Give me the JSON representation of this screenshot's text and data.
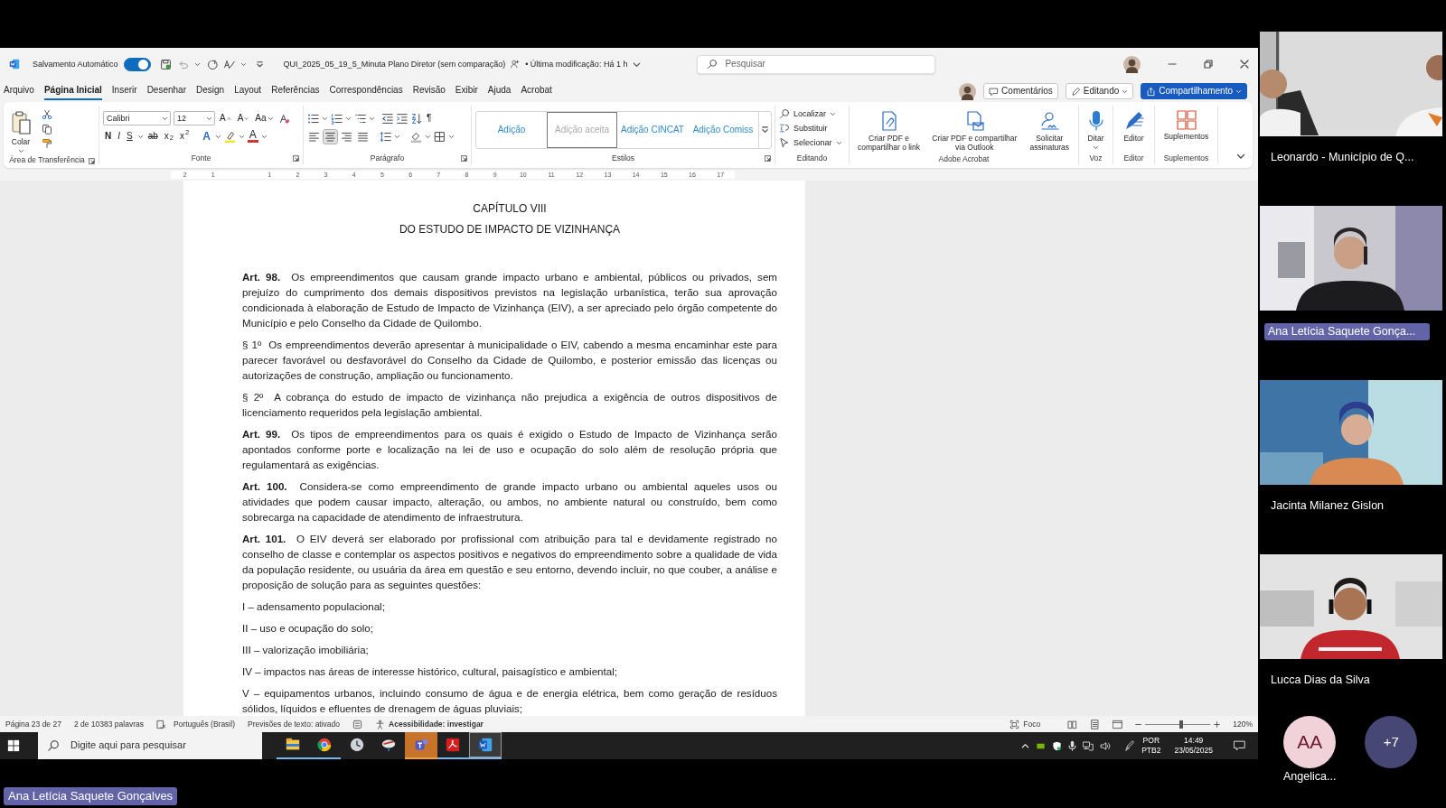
{
  "title_bar": {
    "autosave_label": "Salvamento Automático",
    "autosave_on": true,
    "document_title": "QUI_2025_05_19_5_Minuta Plano Diretor (sem comparação)",
    "last_modified": "• Última modificação: Há 1 h",
    "search_placeholder": "Pesquisar"
  },
  "ribbon_tabs": [
    {
      "label": "Arquivo",
      "selected": false
    },
    {
      "label": "Página Inicial",
      "selected": true
    },
    {
      "label": "Inserir",
      "selected": false
    },
    {
      "label": "Desenhar",
      "selected": false
    },
    {
      "label": "Design",
      "selected": false
    },
    {
      "label": "Layout",
      "selected": false
    },
    {
      "label": "Referências",
      "selected": false
    },
    {
      "label": "Correspondências",
      "selected": false
    },
    {
      "label": "Revisão",
      "selected": false
    },
    {
      "label": "Exibir",
      "selected": false
    },
    {
      "label": "Ajuda",
      "selected": false
    },
    {
      "label": "Acrobat",
      "selected": false
    }
  ],
  "header_buttons": {
    "comments": "Comentários",
    "editing": "Editando",
    "share": "Compartilhamento"
  },
  "ribbon": {
    "clipboard": {
      "paste": "Colar",
      "group": "Área de Transferência"
    },
    "font": {
      "name": "Calibri",
      "size": "12",
      "size_buttons": [
        "A",
        "A"
      ],
      "case_button": "Aa",
      "format_buttons": [
        "N",
        "I",
        "S",
        "ab",
        "x$_{2}$",
        "x$^{2}$"
      ],
      "effect_buttons": [
        "A",
        "A"
      ],
      "group": "Fonte"
    },
    "paragraph": {
      "pilcrow": "¶",
      "align_buttons": [
        {
          "selected": false
        },
        {
          "selected": true
        },
        {
          "selected": false
        },
        {
          "selected": false
        }
      ],
      "group": "Parágrafo"
    },
    "styles": {
      "items": [
        {
          "label": "Adição",
          "selected": false
        },
        {
          "label": "Adição aceita",
          "selected": true
        },
        {
          "label": "Adição CINCAT",
          "selected": false
        },
        {
          "label": "Adição Comiss",
          "selected": false
        }
      ],
      "group": "Estilos"
    },
    "editing": {
      "items": [
        "Localizar",
        "Substituir",
        "Selecionar"
      ],
      "group": "Editando"
    },
    "acrobat": {
      "items": [
        "Criar PDF e compartilhar o link",
        "Criar PDF e compartilhar via Outlook",
        "Solicitar assinaturas"
      ],
      "group": "Adobe Acrobat"
    },
    "voice": {
      "button": "Ditar",
      "group": "Voz"
    },
    "editor": {
      "button": "Editor",
      "group": "Editor"
    },
    "addins": {
      "button": "Suplementos",
      "group": "Suplementos"
    }
  },
  "ruler": {
    "marks": [
      "2",
      "1",
      "1",
      "2",
      "3",
      "4",
      "5",
      "6",
      "7",
      "8",
      "9",
      "10",
      "11",
      "12",
      "13",
      "14",
      "15",
      "16",
      "17"
    ]
  },
  "document": {
    "blocks": [
      {
        "kind": "heading",
        "text": "CAPÍTULO VIII"
      },
      {
        "kind": "heading",
        "text": "DO ESTUDO DE IMPACTO DE VIZINHANÇA"
      },
      {
        "kind": "paragraph",
        "text": "**Art. 98.**  Os empreendimentos que causam grande impacto urbano e ambiental, públicos ou privados, sem prejuízo do cumprimento dos demais dispositivos previstos na legislação urbanística, terão sua aprovação condicionada à elaboração de Estudo de Impacto de Vizinhança (EIV), a ser apreciado pelo órgão competente do Município e pelo Conselho da Cidade de Quilombo."
      },
      {
        "kind": "paragraph",
        "text": "§ 1º  Os empreendimentos deverão apresentar à municipalidade o EIV, cabendo a mesma encaminhar este para parecer favorável ou desfavorável do Conselho da Cidade de Quilombo, e posterior emissão das licenças ou autorizações de construção, ampliação ou funcionamento."
      },
      {
        "kind": "paragraph",
        "text": "§ 2º  A cobrança do estudo de impacto de vizinhança não prejudica a exigência de outros dispositivos de licenciamento requeridos pela legislação ambiental."
      },
      {
        "kind": "paragraph",
        "text": "**Art. 99.**  Os tipos de empreendimentos para os quais é exigido o Estudo de Impacto de Vizinhança serão apontados conforme porte e localização na lei de uso e ocupação do solo além de resolução própria que regulamentará as exigências."
      },
      {
        "kind": "paragraph",
        "text": "**Art. 100.**  Considera-se como empreendimento de grande impacto urbano ou ambiental aqueles usos ou atividades que podem causar impacto, alteração, ou ambos, no ambiente natural ou construído, bem como sobrecarga na capacidade de atendimento de infraestrutura."
      },
      {
        "kind": "paragraph",
        "text": "**Art. 101.**  O EIV deverá ser elaborado por profissional com atribuição para tal e devidamente registrado no conselho de classe e contemplar os aspectos positivos e negativos do empreendimento sobre a qualidade de vida da população residente, ou usuária da área em questão e seu entorno, devendo incluir, no que couber, a análise e proposição de solução para as seguintes questões:"
      },
      {
        "kind": "item",
        "text": "I – adensamento populacional;"
      },
      {
        "kind": "item",
        "text": "II – uso e ocupação do solo;"
      },
      {
        "kind": "item",
        "text": "III – valorização imobiliária;"
      },
      {
        "kind": "item",
        "text": "IV – impactos nas áreas de interesse histórico, cultural, paisagístico e ambiental;"
      },
      {
        "kind": "paragraph",
        "text": "V – equipamentos urbanos, incluindo consumo de água e de energia elétrica, bem como geração de resíduos sólidos, líquidos e efluentes de drenagem de águas pluviais;"
      }
    ]
  },
  "status_bar": {
    "page": "Página 23 de 27",
    "words": "2 de 10383 palavras",
    "language": "Português (Brasil)",
    "predictions": "Previsões de texto: ativado",
    "accessibility": "Acessibilidade: investigar",
    "focus": "Foco",
    "zoom_slider": {
      "level": 0.56
    },
    "zoom": "120%"
  },
  "taskbar": {
    "search_placeholder": "Digite aqui para pesquisar",
    "apps": [
      {
        "open": true,
        "selected": false,
        "attention": false
      },
      {
        "open": true,
        "selected": false,
        "attention": false
      },
      {
        "open": false,
        "selected": false,
        "attention": false
      },
      {
        "open": false,
        "selected": false,
        "attention": false
      },
      {
        "open": true,
        "selected": false,
        "attention": true
      },
      {
        "open": true,
        "selected": false,
        "attention": false
      },
      {
        "open": true,
        "selected": true,
        "attention": false
      }
    ],
    "language": "POR",
    "layout": "PTB2",
    "time": "14:49",
    "date": "23/05/2025"
  },
  "participants": [
    {
      "name": "Leonardo - Município de Q...",
      "highlighted": false
    },
    {
      "name": "Ana Letícia Saquete Gonça...",
      "highlighted": true
    },
    {
      "name": "Jacinta Milanez Gislon",
      "highlighted": false
    },
    {
      "name": "Lucca Dias da Silva",
      "highlighted": false
    }
  ],
  "more_participants": {
    "initials": "AA",
    "name": "Angelica...",
    "count": "+7"
  },
  "presenter_label": "Ana Letícia Saquete Gonçalves"
}
